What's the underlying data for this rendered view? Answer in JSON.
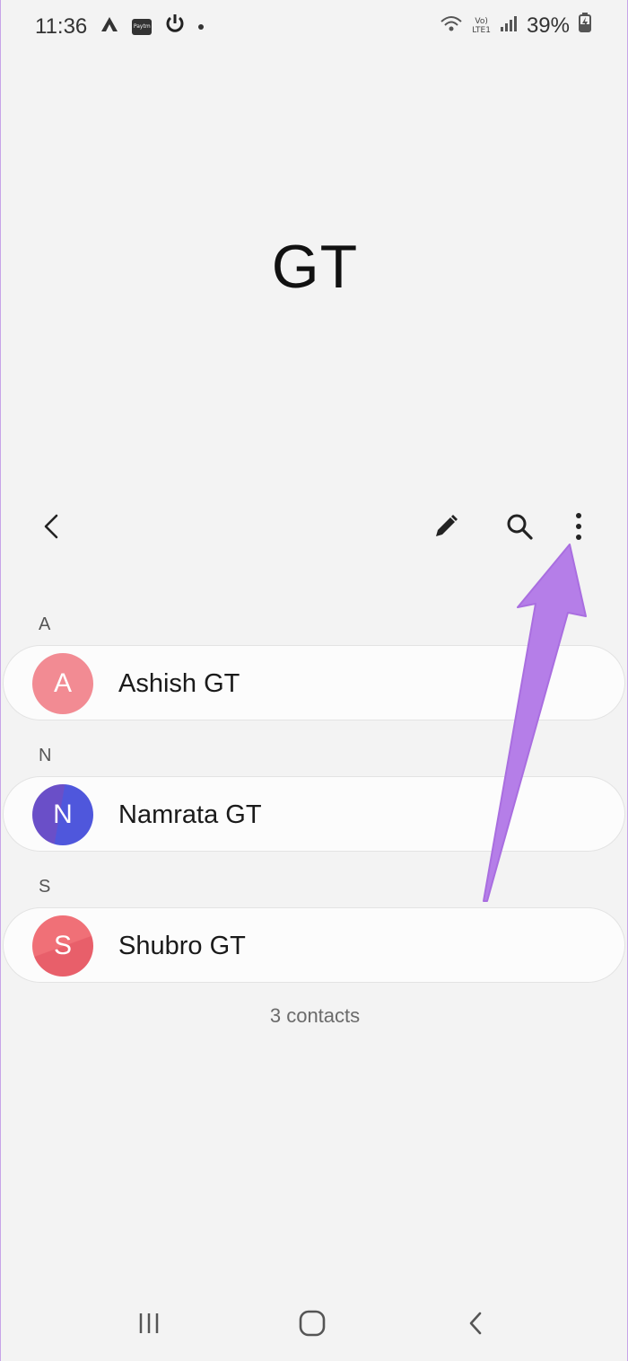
{
  "status_bar": {
    "time": "11:36",
    "paytm_label": "Paytm",
    "network_label_top": "Vo)",
    "network_label_bottom": "LTE1",
    "battery": "39%"
  },
  "header": {
    "title": "GT"
  },
  "toolbar": {
    "icons": [
      "back-icon",
      "edit-icon",
      "search-icon",
      "more-options-icon"
    ]
  },
  "sections": [
    {
      "letter": "A",
      "contacts": [
        {
          "initial": "A",
          "name": "Ashish GT",
          "color": "#f28b93"
        }
      ]
    },
    {
      "letter": "N",
      "contacts": [
        {
          "initial": "N",
          "name": "Namrata GT",
          "color": "#5a4fd6"
        }
      ]
    },
    {
      "letter": "S",
      "contacts": [
        {
          "initial": "S",
          "name": "Shubro GT",
          "color": "#ee6b73"
        }
      ]
    }
  ],
  "footer": {
    "count_label": "3 contacts"
  },
  "nav_bar": {
    "icons": [
      "recent-apps-icon",
      "home-icon",
      "back-nav-icon"
    ]
  },
  "colors": {
    "background": "#f3f3f3",
    "card": "#fcfcfc",
    "annotation_arrow": "#b57ee8"
  }
}
